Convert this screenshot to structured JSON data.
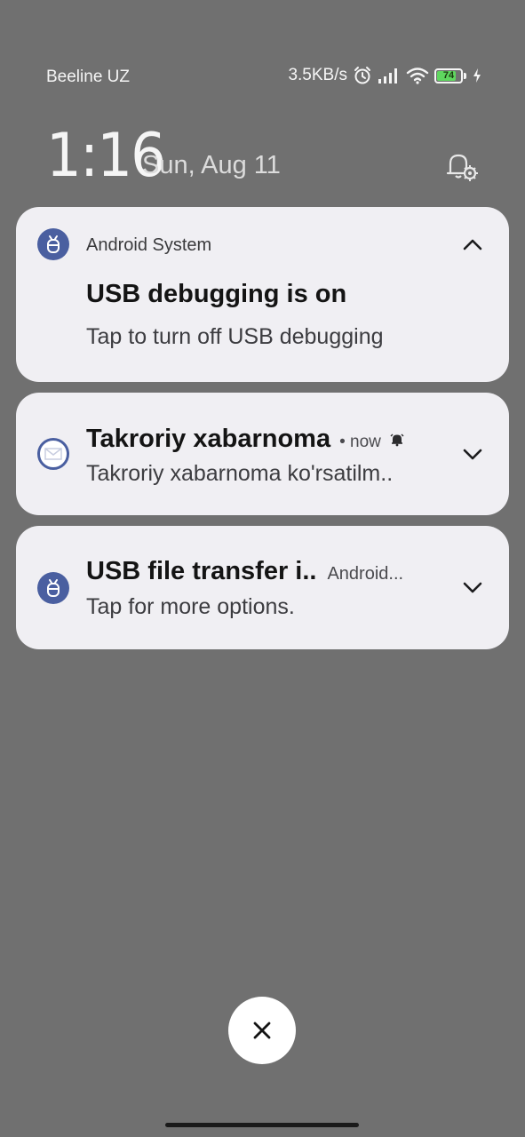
{
  "status_bar": {
    "carrier": "Beeline UZ",
    "net_speed": "3.5KB/s",
    "battery_level": "74",
    "icons": [
      "alarm-icon",
      "signal-icon",
      "wifi-icon",
      "battery-icon",
      "charging-icon"
    ]
  },
  "clock": {
    "time": "1:16",
    "date": "Sun, Aug 11"
  },
  "notifications": [
    {
      "app_name": "Android System",
      "title": "USB debugging is on",
      "body": "Tap to turn off USB debugging",
      "expanded": true,
      "icon": "android-debug-icon"
    },
    {
      "title": "Takroriy xabarnoma",
      "meta": "• now",
      "body": "Takroriy xabarnoma ko'rsatilm..",
      "expanded": false,
      "icon": "mail-app-icon"
    },
    {
      "title": "USB file transfer i..",
      "meta": "Android...",
      "body": "Tap for more options.",
      "expanded": false,
      "icon": "android-debug-icon"
    }
  ],
  "colors": {
    "background": "#707070",
    "card": "#f0eff3",
    "icon_blue": "#4a5fa0",
    "battery_green": "#5fd65f"
  }
}
